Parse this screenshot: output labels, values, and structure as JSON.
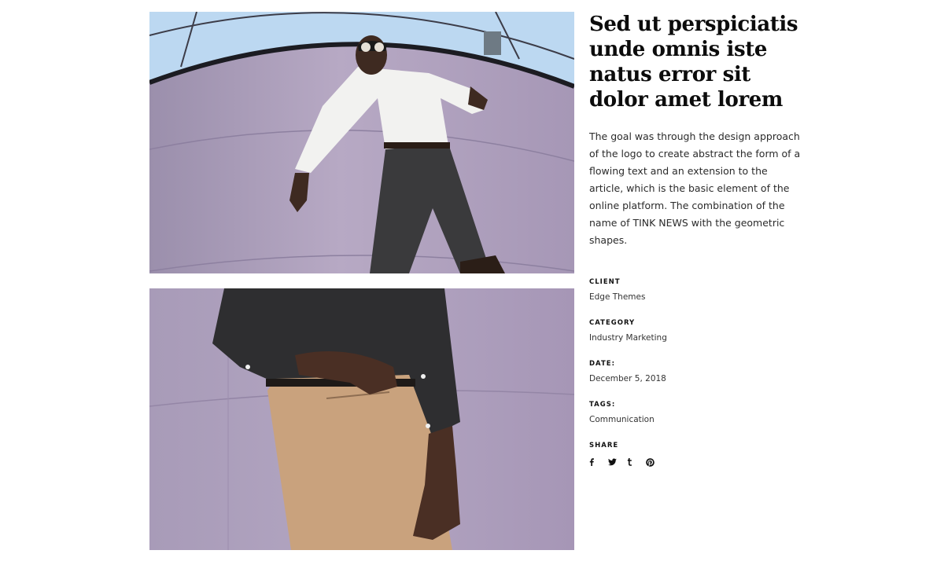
{
  "project": {
    "title": "Sed ut perspiciatis unde omnis iste natus error sit dolor amet lorem",
    "description": "The goal was through the design approach of the logo to create abstract the form of a flowing text and an extension to the article, which is the basic element of the online platform. The combination of the name of TINK NEWS with the geometric shapes."
  },
  "meta": {
    "client": {
      "label": "CLIENT",
      "value": "Edge Themes"
    },
    "category": {
      "label": "CATEGORY",
      "value": "Industry Marketing"
    },
    "date": {
      "label": "DATE:",
      "value": "December 5, 2018"
    },
    "tags": {
      "label": "TAGS:",
      "value": "Communication"
    },
    "share": {
      "label": "SHARE"
    }
  },
  "share_icons": [
    "facebook-icon",
    "twitter-icon",
    "tumblr-icon",
    "pinterest-icon"
  ],
  "colors": {
    "wall": "#a99bb6",
    "sky": "#b9d6ef",
    "shirt_white": "#f2f2f0",
    "trousers_dark": "#3a3a3c",
    "shirt_black": "#2e2e30",
    "trousers_tan": "#c9a27d",
    "skin": "#4a2f24"
  }
}
